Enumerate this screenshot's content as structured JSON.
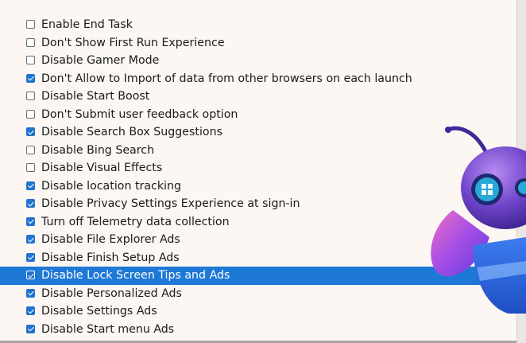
{
  "options": [
    {
      "label": "Enable End Task",
      "checked": false,
      "selected": false
    },
    {
      "label": "Don't Show First Run Experience",
      "checked": false,
      "selected": false
    },
    {
      "label": "Disable Gamer Mode",
      "checked": false,
      "selected": false
    },
    {
      "label": "Don't Allow to Import of data from other browsers on each launch",
      "checked": true,
      "selected": false
    },
    {
      "label": "Disable Start Boost",
      "checked": false,
      "selected": false
    },
    {
      "label": "Don't Submit user feedback option",
      "checked": false,
      "selected": false
    },
    {
      "label": "Disable Search Box Suggestions",
      "checked": true,
      "selected": false
    },
    {
      "label": "Disable Bing Search",
      "checked": false,
      "selected": false
    },
    {
      "label": "Disable Visual Effects",
      "checked": false,
      "selected": false
    },
    {
      "label": "Disable location tracking",
      "checked": true,
      "selected": false
    },
    {
      "label": "Disable Privacy Settings Experience at sign-in",
      "checked": true,
      "selected": false
    },
    {
      "label": "Turn off Telemetry data collection",
      "checked": true,
      "selected": false
    },
    {
      "label": "Disable File Explorer Ads",
      "checked": true,
      "selected": false
    },
    {
      "label": "Disable Finish Setup Ads",
      "checked": true,
      "selected": false
    },
    {
      "label": "Disable Lock Screen Tips and Ads",
      "checked": true,
      "selected": true
    },
    {
      "label": "Disable Personalized Ads",
      "checked": true,
      "selected": false
    },
    {
      "label": "Disable Settings Ads",
      "checked": true,
      "selected": false
    },
    {
      "label": "Disable Start menu Ads",
      "checked": true,
      "selected": false
    }
  ],
  "colors": {
    "checkbox_checked": "#2272cf",
    "selection": "#1e78d6",
    "background": "#fcf7f3"
  },
  "icons": {
    "mascot": "bee-mascot-icon",
    "badge": "windows-logo-icon"
  }
}
